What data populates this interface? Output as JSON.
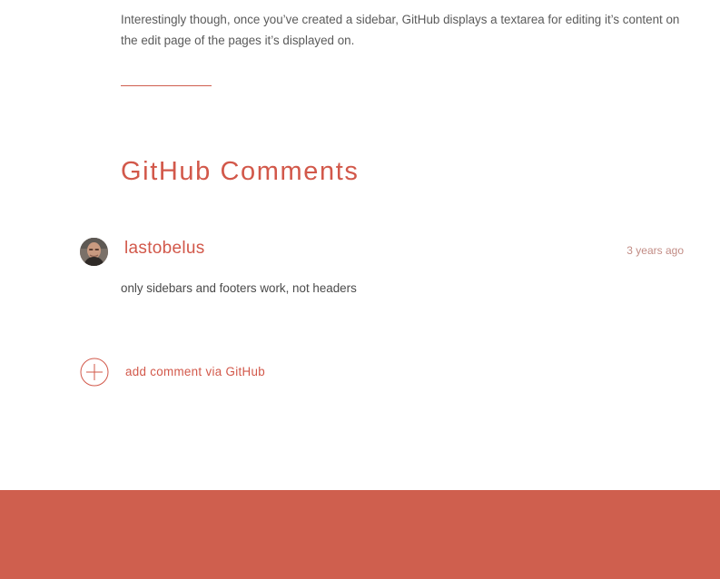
{
  "intro": {
    "paragraph": "Interestingly though, once you’ve created a sidebar, GitHub displays a textarea for editing it’s content on the edit page of the pages it’s displayed on."
  },
  "comments": {
    "heading": "GitHub Comments",
    "items": [
      {
        "author": "lastobelus",
        "time": "3 years ago",
        "body": "only sidebars and footers work, not headers"
      }
    ],
    "add_comment_label": "add comment via GitHub"
  },
  "colors": {
    "accent": "#d2584a",
    "footer": "#cf5f4e",
    "body_text": "#4a4a4a",
    "timestamp": "#c28c85"
  },
  "icons": {
    "avatar": "user-photo",
    "add": "plus-circle-icon"
  }
}
